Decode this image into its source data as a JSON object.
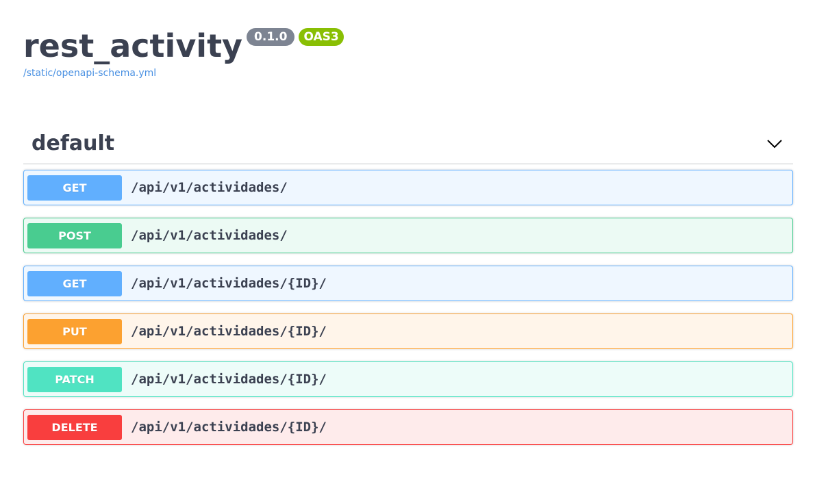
{
  "info": {
    "title": "rest_activity",
    "version": "0.1.0",
    "oas_badge": "OAS3",
    "spec_link": "/static/openapi-schema.yml"
  },
  "section": {
    "title": "default",
    "toggle_icon": "chevron-down-icon"
  },
  "operations": [
    {
      "method": "GET",
      "path": "/api/v1/actividades/"
    },
    {
      "method": "POST",
      "path": "/api/v1/actividades/"
    },
    {
      "method": "GET",
      "path": "/api/v1/actividades/{ID}/"
    },
    {
      "method": "PUT",
      "path": "/api/v1/actividades/{ID}/"
    },
    {
      "method": "PATCH",
      "path": "/api/v1/actividades/{ID}/"
    },
    {
      "method": "DELETE",
      "path": "/api/v1/actividades/{ID}/"
    }
  ],
  "colors": {
    "get": "#61affe",
    "post": "#49cc90",
    "put": "#fca130",
    "patch": "#50e3c2",
    "delete": "#f93e3e",
    "version_badge": "#7d8492",
    "oas_badge": "#89bf04",
    "link": "#4990e2",
    "text": "#3b4151"
  }
}
